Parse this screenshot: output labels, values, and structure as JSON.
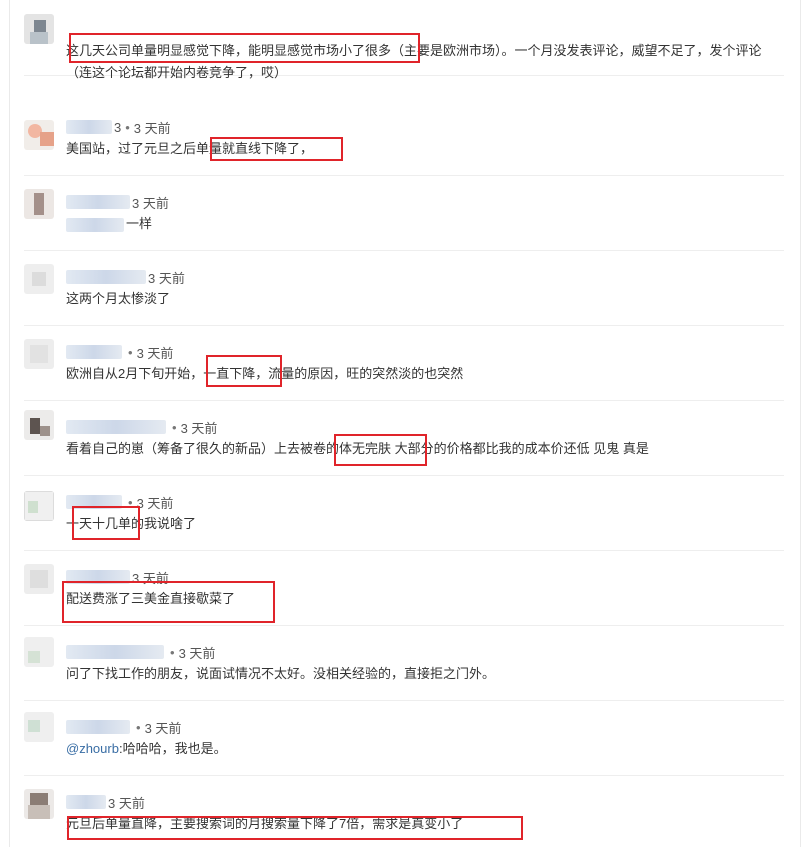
{
  "comments": [
    {
      "blur_width": 0,
      "has_meta": false,
      "author_suffix": "",
      "time": "",
      "text": "这几天公司单量明显感觉下降，能明显感觉市场小了很多（主要是欧洲市场）。一个月没发表评论，威望不足了，发个评论（连这个论坛都开始内卷竞争了，哎）"
    },
    {
      "blur_width": 46,
      "has_meta": true,
      "author_suffix": "3",
      "time": "3 天前",
      "text": "美国站，过了元旦之后单量就直线下降了，"
    },
    {
      "blur_width": 64,
      "has_meta": true,
      "author_suffix": "",
      "time": "3 天前",
      "text": "一样"
    },
    {
      "blur_width": 80,
      "has_meta": true,
      "author_suffix": "",
      "time": "3 天前",
      "text": "这两个月太惨淡了"
    },
    {
      "blur_width": 56,
      "has_meta": true,
      "author_suffix": "",
      "time": "3 天前",
      "text": "欧洲自从2月下旬开始，一直下降，流量的原因，旺的突然淡的也突然"
    },
    {
      "blur_width": 100,
      "has_meta": true,
      "author_suffix": "",
      "time": "3 天前",
      "text": "看着自己的崽（筹备了很久的新品）上去被卷的体无完肤 大部分的价格都比我的成本价还低 见鬼 真是"
    },
    {
      "blur_width": 56,
      "has_meta": true,
      "author_suffix": "",
      "time": "3 天前",
      "text": "一天十几单的我说啥了"
    },
    {
      "blur_width": 64,
      "has_meta": true,
      "author_suffix": "",
      "time": "3 天前",
      "text": "配送费涨了三美金直接歇菜了"
    },
    {
      "blur_width": 98,
      "has_meta": true,
      "author_suffix": "",
      "time": "3 天前",
      "text": "问了下找工作的朋友，说面试情况不太好。没相关经验的，直接拒之门外。"
    },
    {
      "blur_width": 64,
      "has_meta": true,
      "author_suffix": "",
      "time": "3 天前",
      "mention": "@zhourb",
      "text": ":哈哈哈，我也是。"
    },
    {
      "blur_width": 40,
      "has_meta": true,
      "author_suffix": "",
      "time": "3 天前",
      "text": "元旦后单量直降，主要搜索词的月搜索量下降了7倍，需求是真变小了"
    }
  ],
  "accent_color": "#e0242a"
}
